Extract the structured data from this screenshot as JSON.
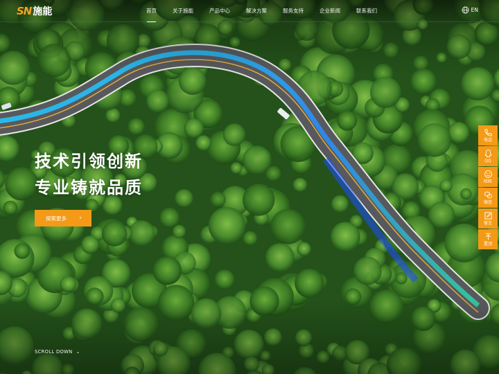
{
  "logo": {
    "mark": "SN",
    "name": "施能"
  },
  "nav": {
    "items": [
      {
        "label": "首页",
        "active": true
      },
      {
        "label": "关于施能"
      },
      {
        "label": "产品中心"
      },
      {
        "label": "解决方案"
      },
      {
        "label": "服务支持"
      },
      {
        "label": "企业新闻"
      },
      {
        "label": "联系我们"
      }
    ]
  },
  "lang": {
    "label": "EN",
    "icon": "globe-icon"
  },
  "hero": {
    "headline_1": "技术引领创新",
    "headline_2": "专业铸就品质",
    "cta_label": "探索更多",
    "cta_arrow": "›",
    "scroll_label": "SCROLL DOWN",
    "scroll_chevron": "⌄"
  },
  "side_tools": [
    {
      "label": "电话",
      "icon": "phone-icon"
    },
    {
      "label": "QQ",
      "icon": "qq-icon"
    },
    {
      "label": "旺旺",
      "icon": "wangwang-icon"
    },
    {
      "label": "微信",
      "icon": "wechat-icon"
    },
    {
      "label": "留言",
      "icon": "message-icon"
    },
    {
      "label": "置顶",
      "icon": "back-to-top-icon"
    }
  ],
  "colors": {
    "accent": "#f49a17",
    "forest": "#2a5e1c",
    "road": "#55585c"
  }
}
